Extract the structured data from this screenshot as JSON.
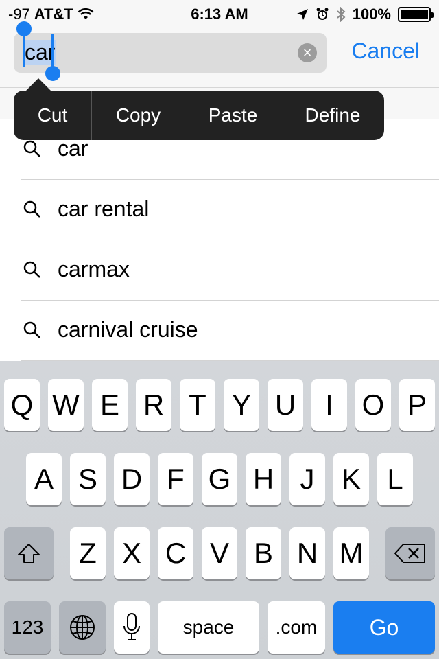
{
  "status_bar": {
    "signal": "-97",
    "carrier": "AT&T",
    "time": "6:13 AM",
    "battery": "100%"
  },
  "search": {
    "query": "car",
    "clear_icon": "clear-x-icon",
    "cancel_label": "Cancel"
  },
  "edit_menu": {
    "items": [
      "Cut",
      "Copy",
      "Paste",
      "Define"
    ]
  },
  "suggestions": [
    {
      "text": "car"
    },
    {
      "text": "car rental"
    },
    {
      "text": "carmax"
    },
    {
      "text": "carnival cruise"
    }
  ],
  "keyboard": {
    "row1": [
      "Q",
      "W",
      "E",
      "R",
      "T",
      "Y",
      "U",
      "I",
      "O",
      "P"
    ],
    "row2": [
      "A",
      "S",
      "D",
      "F",
      "G",
      "H",
      "J",
      "K",
      "L"
    ],
    "row3": [
      "Z",
      "X",
      "C",
      "V",
      "B",
      "N",
      "M"
    ],
    "numbers_label": "123",
    "space_label": "space",
    "dotcom_label": ".com",
    "go_label": "Go"
  },
  "colors": {
    "accent": "#1a7ef0",
    "menu_bg": "#222222",
    "keyboard_bg": "#d3d6da"
  }
}
